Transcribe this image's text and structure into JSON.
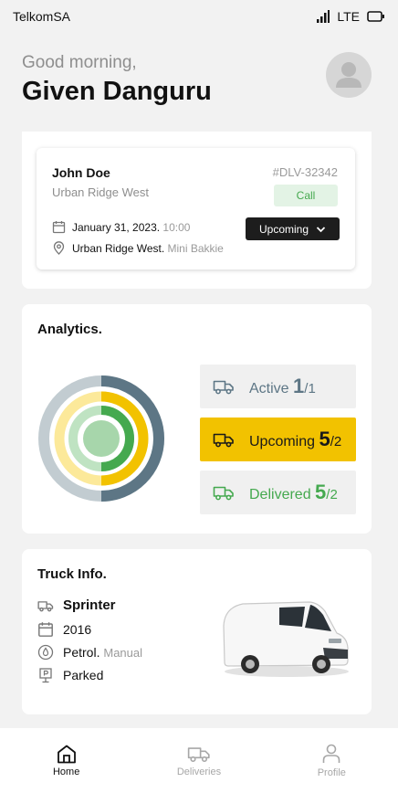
{
  "status_bar": {
    "carrier": "TelkomSA",
    "network": "LTE"
  },
  "header": {
    "greeting": "Good morning,",
    "user_name": "Given Danguru"
  },
  "delivery": {
    "customer_name": "John Doe",
    "area": "Urban Ridge West",
    "id": "#DLV-32342",
    "call_label": "Call",
    "date": "January 31, 2023.",
    "time": "10:00",
    "location": "Urban Ridge West.",
    "vehicle": "Mini Bakkie",
    "status": "Upcoming"
  },
  "analytics": {
    "title": "Analytics.",
    "stats": [
      {
        "label": "Active",
        "value": "1",
        "total": "/1",
        "color": "#5d7685"
      },
      {
        "label": "Upcoming",
        "value": "5",
        "total": "/2",
        "color": "#f2c200"
      },
      {
        "label": "Delivered",
        "value": "5",
        "total": "/2",
        "color": "#45a94f"
      }
    ],
    "ring_colors": {
      "outer": "#5d7685",
      "middle": "#f2c200",
      "inner": "#45a94f"
    }
  },
  "truck": {
    "title": "Truck Info.",
    "model": "Sprinter",
    "year": "2016",
    "fuel": "Petrol.",
    "transmission": "Manual",
    "state": "Parked"
  },
  "nav": [
    {
      "label": "Home",
      "icon": "home-icon",
      "active": true
    },
    {
      "label": "Deliveries",
      "icon": "truck-icon",
      "active": false
    },
    {
      "label": "Profile",
      "icon": "user-icon",
      "active": false
    }
  ]
}
